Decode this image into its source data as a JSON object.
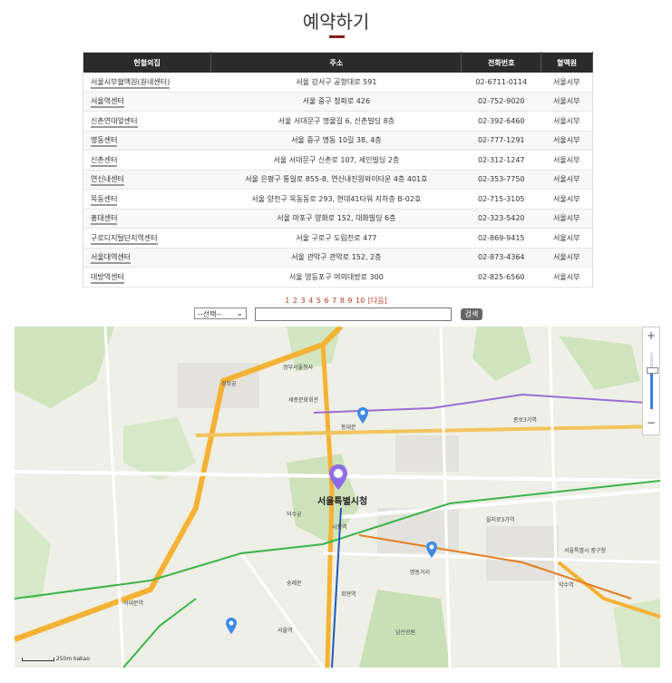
{
  "page": {
    "title": "예약하기"
  },
  "table": {
    "headers": [
      "헌혈의집",
      "주소",
      "전화번호",
      "혈액원"
    ],
    "rows": [
      [
        "서울시부혈액원(원내센터)",
        "서울 강서구 공항대로 591",
        "02-6711-0114",
        "서울시부"
      ],
      [
        "서울역센터",
        "서울 중구 청파로 426",
        "02-752-9020",
        "서울시부"
      ],
      [
        "신촌연대앞센터",
        "서울 서대문구 명물길 6, 신촌빌딩 8층",
        "02-392-6460",
        "서울시부"
      ],
      [
        "명동센터",
        "서울 중구 명동 10길 38, 4층",
        "02-777-1291",
        "서울시부"
      ],
      [
        "신촌센터",
        "서울 서대문구 신촌로 107, 세인빌딩 2층",
        "02-312-1247",
        "서울시부"
      ],
      [
        "연신내센터",
        "서울 은평구 통일로 855-8, 연신내진원와이타운 4층 401호",
        "02-353-7750",
        "서울시부"
      ],
      [
        "목동센터",
        "서울 양천구 목동동로 293, 현대41타워 지하층 B-02호",
        "02-715-3105",
        "서울시부"
      ],
      [
        "홍대센터",
        "서울 마포구 양화로 152, 대화빌딩 6층",
        "02-323-5420",
        "서울시부"
      ],
      [
        "구로디지털단지역센터",
        "서울 구로구 도림천로 477",
        "02-869-9415",
        "서울시부"
      ],
      [
        "서울대역센터",
        "서울 관악구 관악로 152, 2층",
        "02-873-4364",
        "서울시부"
      ],
      [
        "대방역센터",
        "서울 영등포구 여의대방로 300",
        "02-825-6560",
        "서울시부"
      ]
    ]
  },
  "pager": {
    "pages": [
      "1",
      "2",
      "3",
      "4",
      "5",
      "6",
      "7",
      "8",
      "9",
      "10"
    ],
    "next_label": "[다음]"
  },
  "search": {
    "region_default": "--선택--",
    "button_label": "검색",
    "input_value": ""
  },
  "map": {
    "center_label": "서울특별시청",
    "labels": [
      "정부서울청사",
      "세종문화회관",
      "경희궁",
      "덕수궁",
      "서울역",
      "동대문",
      "명동거리",
      "남산공원",
      "서울특별시 중구청",
      "서대문역",
      "시청역",
      "종로3가역",
      "을지로3가역",
      "숭례문",
      "회현역",
      "약수역"
    ],
    "scale_label": "250m",
    "brand": "kakao",
    "zoom_level": 0.7
  },
  "colors": {
    "accent": "#8b1a1a",
    "pager": "#c0392b",
    "header_bg": "#2b2b2b",
    "pin": "#3d8be6",
    "road_major": "#f5b335"
  }
}
